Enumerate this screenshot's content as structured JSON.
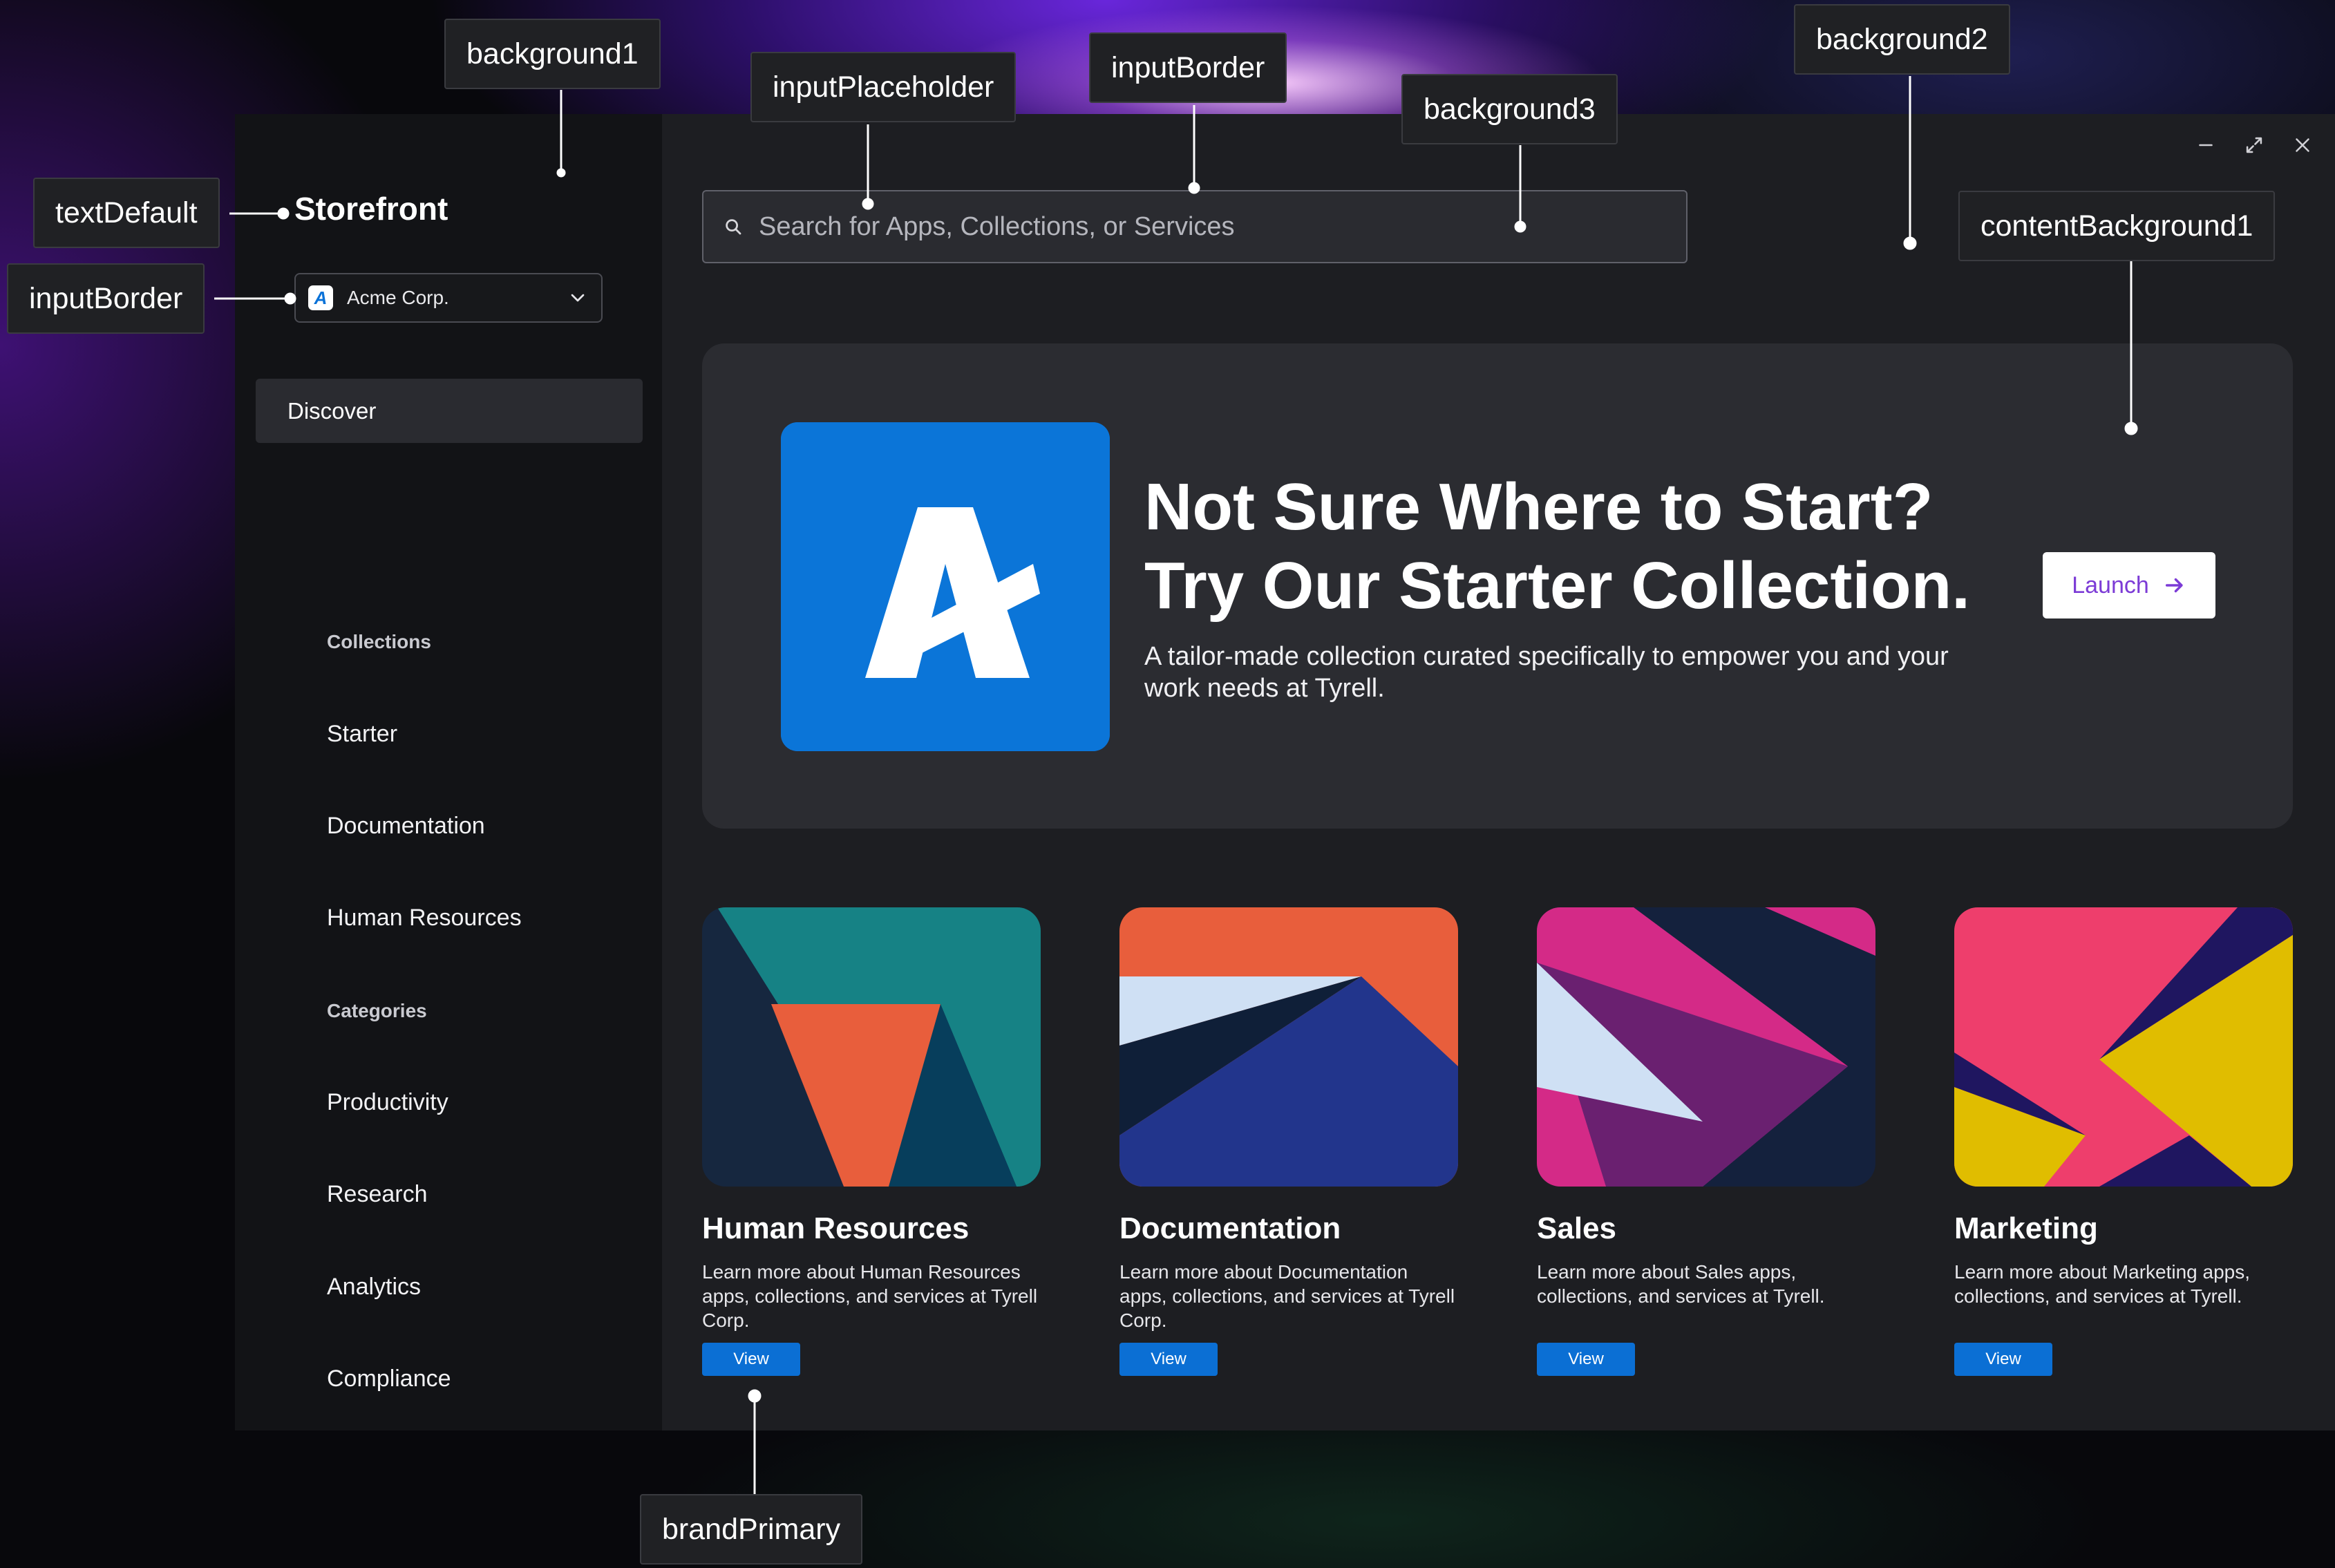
{
  "app": {
    "title": "Storefront",
    "org_selector": {
      "logo_letter": "A",
      "value": "Acme Corp."
    }
  },
  "sidebar": {
    "discover": "Discover",
    "sections": [
      {
        "heading": "Collections",
        "items": [
          "Starter",
          "Documentation",
          "Human Resources"
        ]
      },
      {
        "heading": "Categories",
        "items": [
          "Productivity",
          "Research",
          "Analytics",
          "Compliance"
        ]
      }
    ]
  },
  "search": {
    "placeholder": "Search for Apps, Collections, or Services"
  },
  "hero": {
    "title_line1": "Not Sure Where to Start?",
    "title_line2": "Try Our Starter Collection.",
    "description": "A tailor-made collection curated specifically to empower you and your work needs at Tyrell.",
    "launch_label": "Launch"
  },
  "cards": [
    {
      "title": "Human Resources",
      "description": "Learn more about Human Resources apps, collections, and services at Tyrell Corp.",
      "button": "View"
    },
    {
      "title": "Documentation",
      "description": "Learn more about Documentation apps, collections, and services at Tyrell Corp.",
      "button": "View"
    },
    {
      "title": "Sales",
      "description": "Learn more about Sales apps, collections, and services at Tyrell.",
      "button": "View"
    },
    {
      "title": "Marketing",
      "description": "Learn more about Marketing apps, collections, and services at Tyrell.",
      "button": "View"
    }
  ],
  "annotations": {
    "background1": "background1",
    "inputPlaceholder": "inputPlaceholder",
    "inputBorder_top": "inputBorder",
    "background3": "background3",
    "background2": "background2",
    "textDefault": "textDefault",
    "inputBorder_side": "inputBorder",
    "contentBackground1": "contentBackground1",
    "brandPrimary": "brandPrimary"
  },
  "colors": {
    "background1": "#121316",
    "background2": "#1d1e22",
    "background3": "#2a2b30",
    "contentBackground1": "#2b2c31",
    "inputBorder": "#4a4b52",
    "brandPrimary": "#0b6fd4",
    "textDefault": "#ffffff",
    "launchText": "#7c3bd6"
  },
  "icons": [
    "search-icon",
    "chevron-down-icon",
    "minimize-icon",
    "maximize-icon",
    "close-icon",
    "arrow-right-icon",
    "acme-logo-icon"
  ]
}
